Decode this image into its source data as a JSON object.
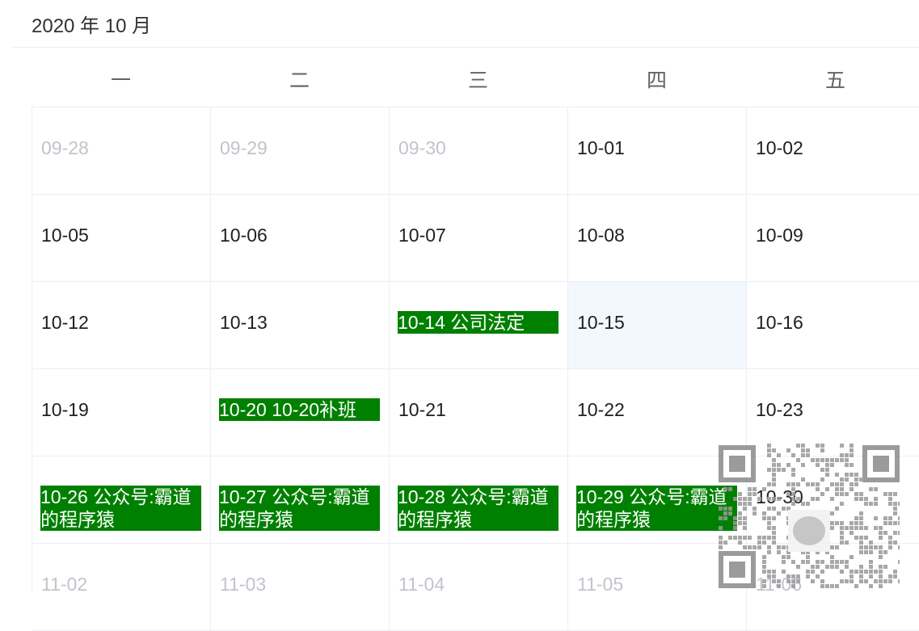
{
  "calendar": {
    "title": "2020 年 10 月",
    "weekdays": [
      "一",
      "二",
      "三",
      "四",
      "五"
    ],
    "rows": [
      [
        {
          "text": "09-28",
          "state": "other-month"
        },
        {
          "text": "09-29",
          "state": "other-month"
        },
        {
          "text": "09-30",
          "state": "other-month"
        },
        {
          "text": "10-01",
          "state": "normal"
        },
        {
          "text": "10-02",
          "state": "normal"
        }
      ],
      [
        {
          "text": "10-05",
          "state": "normal"
        },
        {
          "text": "10-06",
          "state": "normal"
        },
        {
          "text": "10-07",
          "state": "normal"
        },
        {
          "text": "10-08",
          "state": "normal"
        },
        {
          "text": "10-09",
          "state": "normal"
        }
      ],
      [
        {
          "text": "10-12",
          "state": "normal"
        },
        {
          "text": "10-13",
          "state": "normal"
        },
        {
          "text": "10-14 公司法定",
          "state": "event"
        },
        {
          "text": "10-15",
          "state": "selected"
        },
        {
          "text": "10-16",
          "state": "normal"
        }
      ],
      [
        {
          "text": "10-19",
          "state": "normal"
        },
        {
          "text": "10-20 10-20补班",
          "state": "event"
        },
        {
          "text": "10-21",
          "state": "normal"
        },
        {
          "text": "10-22",
          "state": "normal"
        },
        {
          "text": "10-23",
          "state": "normal"
        }
      ],
      [
        {
          "text": "10-26 公众号:霸道的程序猿",
          "state": "event"
        },
        {
          "text": "10-27 公众号:霸道的程序猿",
          "state": "event"
        },
        {
          "text": "10-28 公众号:霸道的程序猿",
          "state": "event"
        },
        {
          "text": "10-29 公众号:霸道的程序猿",
          "state": "event"
        },
        {
          "text": "10-30",
          "state": "normal"
        }
      ],
      [
        {
          "text": "11-02",
          "state": "other-month"
        },
        {
          "text": "11-03",
          "state": "other-month"
        },
        {
          "text": "11-04",
          "state": "other-month"
        },
        {
          "text": "11-05",
          "state": "other-month"
        },
        {
          "text": "11-06",
          "state": "other-month"
        }
      ]
    ]
  },
  "colors": {
    "event_bg": "#008000",
    "selected_bg": "#f2f8fe",
    "muted_text": "#c0c4cc",
    "border": "#ebeef5"
  },
  "overlay": {
    "icon": "qr-code-icon"
  }
}
